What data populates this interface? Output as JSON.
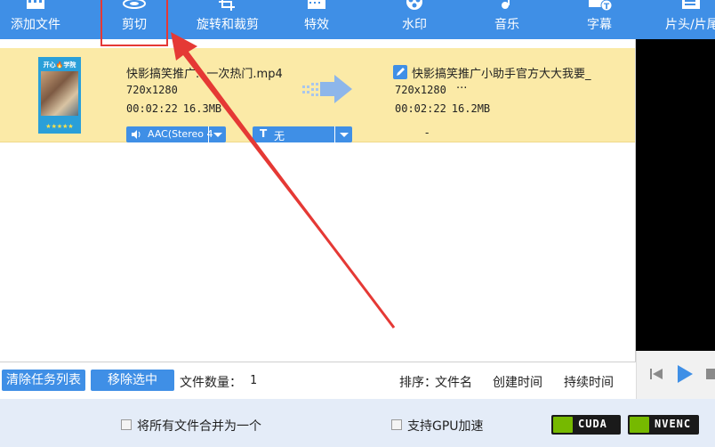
{
  "toolbar": {
    "items": [
      {
        "label": "添加文件",
        "icon": "film-add-icon"
      },
      {
        "label": "剪切",
        "icon": "scissors-icon"
      },
      {
        "label": "旋转和裁剪",
        "icon": "rotate-crop-icon"
      },
      {
        "label": "特效",
        "icon": "effects-icon"
      },
      {
        "label": "水印",
        "icon": "watermark-icon"
      },
      {
        "label": "音乐",
        "icon": "music-icon"
      },
      {
        "label": "字幕",
        "icon": "subtitle-icon"
      },
      {
        "label": "片头/片尾",
        "icon": "intro-outro-icon"
      }
    ],
    "highlighted": "剪切",
    "bg_color": "#3f8fe6"
  },
  "task": {
    "thumbnail": {
      "title": "开心🔥学院",
      "stars": "★★★★★"
    },
    "source": {
      "name": "快影搞笑推广...一次热门.mp4",
      "resolution": "720x1280",
      "duration": "00:02:22",
      "size": "16.3MB"
    },
    "output": {
      "name": "快影搞笑推广小助手官方大大我要_",
      "resolution": "720x1280",
      "more": "···",
      "duration": "00:02:22",
      "size": "16.2MB",
      "extra": "-"
    },
    "audio_track": "AAC(Stereo 4",
    "subtitle": {
      "icon_text": "T",
      "value": "无"
    }
  },
  "actions": {
    "clear_tasks": "清除任务列表",
    "remove_selected": "移除选中",
    "file_count_label": "文件数量：",
    "file_count": "1",
    "sort_label": "排序：",
    "sort_by_name": "文件名",
    "sort_by_created": "创建时间",
    "sort_by_duration": "持续时间"
  },
  "footer": {
    "merge_label": "将所有文件合并为一个",
    "merge_checked": false,
    "gpu_label": "支持GPU加速",
    "gpu_checked": false,
    "badges": [
      "CUDA",
      "NVENC"
    ]
  },
  "colors": {
    "accent": "#3f8fe6",
    "row_highlight": "#fbeaa7",
    "annotation": "#e53935",
    "preview_bg": "#000000",
    "footer_bg": "#e4ecf8"
  }
}
